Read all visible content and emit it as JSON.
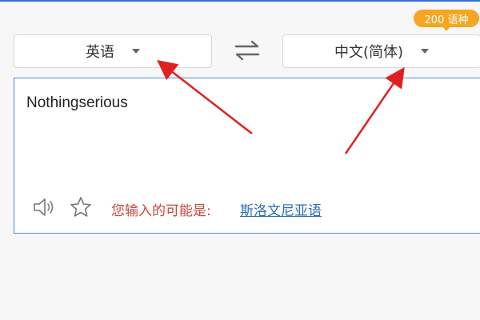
{
  "header": {
    "language_count_badge": "200 语种"
  },
  "language_bar": {
    "source_language": "英语",
    "target_language": "中文(简体)",
    "swap_icon": "swap-arrows-icon"
  },
  "input": {
    "text": "Nothingserious"
  },
  "suggestion": {
    "label": "您输入的可能是:",
    "link": "斯洛文尼亚语"
  },
  "toolbar": {
    "sound_icon": "speaker-icon",
    "star_icon": "star-icon"
  },
  "colors": {
    "accent_border": "#4a90d9",
    "badge": "#f5a623",
    "suggestion_label": "#c9473b",
    "link": "#2a6db7",
    "annotation_arrow": "#e02020"
  }
}
